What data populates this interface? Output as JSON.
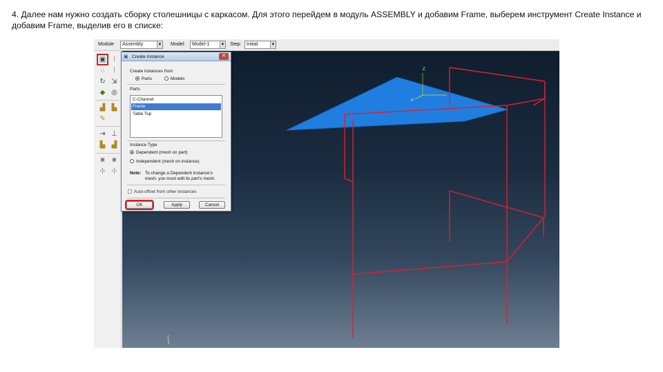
{
  "caption": "4. Далее нам нужно создать сборку столешницы с каркасом. Для этого перейдем в модуль ASSEMBLY и добавим Frame, выберем инструмент Create Instance и добавим Frame, выделив его в списке:",
  "context_bar": {
    "module_label": "Module",
    "module_value": "Assembly",
    "model_label": "Model:",
    "model_value": "Model-1",
    "step_label": "Step:",
    "step_value": "Initial"
  },
  "dialog": {
    "title": "Create Instance",
    "close_label": "✕",
    "create_from_label": "Create instances from",
    "radio_parts": "Parts",
    "radio_models": "Models",
    "parts_label": "Parts",
    "parts_list": [
      "C-Channel",
      "Frame",
      "Table Top"
    ],
    "selected_part": "Frame",
    "instance_type_label": "Instance Type",
    "dependent_label": "Dependent (mesh on part)",
    "independent_label": "Independent (mesh on instance)",
    "note_label": "Note:",
    "note_line1": "To change a Dependent instance's",
    "note_line2": "mesh, you must edit its part's mesh.",
    "auto_offset_label": "Auto-offset from other instances",
    "ok_label": "OK",
    "apply_label": "Apply",
    "cancel_label": "Cancel"
  },
  "toolbox": {
    "icons": [
      "create-instance-icon",
      "linear-pattern-icon",
      "radial-pattern-icon",
      "translate-instance-icon",
      "rotate-instance-icon",
      "translate-to-icon",
      "instance-manager-icon",
      "merge-cut-icon",
      "replace-instance-icon",
      "parallel-face-icon",
      "face-to-face-icon",
      "parallel-edge-icon",
      "edge-to-edge-icon",
      "coaxial-icon",
      "contact-icon",
      "coincident-point-icon",
      "parallel-csys-icon",
      "position-manager-icon",
      "datum-point-icon",
      "datum-axis-icon",
      "datum-plane-icon",
      "datum-csys-icon"
    ]
  },
  "viewport": {
    "triad_label_z": "Z",
    "triad_label_x": "X",
    "mini_triad_label": "Z",
    "tabletop_color": "#1f7ee0",
    "frame_color": "#e0202a"
  },
  "colors": {
    "highlight": "#d62020",
    "selection": "#3d7bd6"
  }
}
